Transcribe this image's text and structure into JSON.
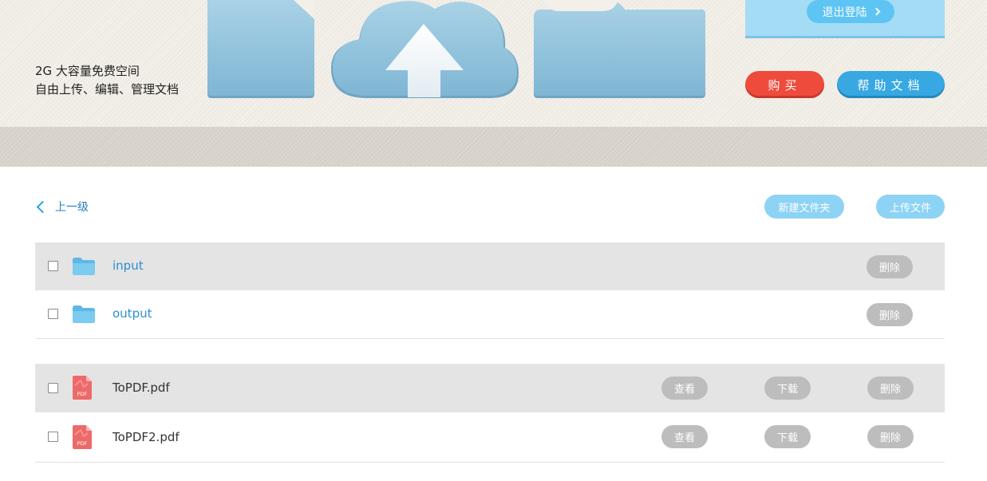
{
  "banner": {
    "tagline_line1": "2G 大容量免费空间",
    "tagline_line2": "自由上传、编辑、管理文档",
    "logout_label": "退出登陆",
    "buy_label": "购买",
    "help_label": "帮助文档"
  },
  "toolbar": {
    "back_label": "上一级",
    "new_folder_label": "新建文件夹",
    "upload_label": "上传文件"
  },
  "folders": [
    {
      "name": "input",
      "delete_label": "删除"
    },
    {
      "name": "output",
      "delete_label": "删除"
    }
  ],
  "files": [
    {
      "name": "ToPDF.pdf",
      "view_label": "查看",
      "download_label": "下载",
      "delete_label": "删除",
      "icon_text": "PDF"
    },
    {
      "name": "ToPDF2.pdf",
      "view_label": "查看",
      "download_label": "下载",
      "delete_label": "删除",
      "icon_text": "PDF"
    }
  ],
  "colors": {
    "accent_blue": "#38a8e3",
    "buy_red": "#ef4b3c",
    "row_shade": "#e4e4e4",
    "button_gray": "#bdbdbd"
  }
}
